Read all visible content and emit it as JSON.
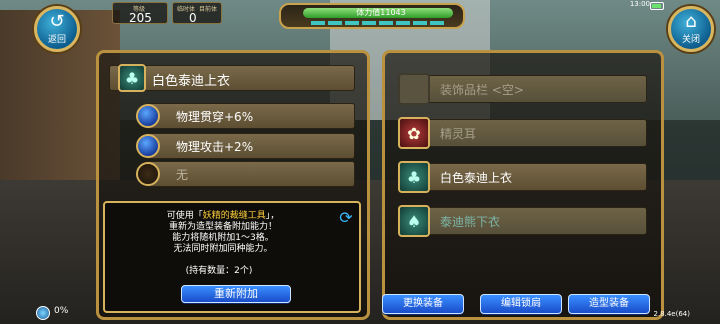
{
  "top": {
    "back_label": "返回",
    "close_label": "关闭",
    "level_label": "等级",
    "level_value": "205",
    "temp_label": "临时体",
    "second_label": "目前体",
    "second_value": "0",
    "stamina_text": "体力值11043",
    "system_time": "13:00"
  },
  "left_panel": {
    "item_name": "白色泰迪上衣",
    "attributes": [
      {
        "label": "物理贯穿+6%",
        "empty": false
      },
      {
        "label": "物理攻击+2%",
        "empty": false
      },
      {
        "label": "无",
        "empty": true
      }
    ],
    "desc_prefix": "可使用「",
    "desc_tool": "妖精的裁缝工具",
    "desc_suffix": "」，",
    "desc_line2": "重新为造型装备附加能力！",
    "desc_line3": "能力将随机附加1～3格。",
    "desc_line4": "无法同时附加同种能力。",
    "desc_count": "(持有数量：2个)",
    "reattach_button": "重新附加"
  },
  "right_panel": {
    "slots": [
      {
        "label": "装饰品栏 <空>",
        "icon": "empty-slot"
      },
      {
        "label": "精灵耳",
        "icon": "red-ribbon-icon"
      },
      {
        "label": "白色泰迪上衣",
        "icon": "teddy-top-icon"
      },
      {
        "label": "泰迪熊下衣",
        "icon": "teddy-bottom-icon"
      }
    ]
  },
  "bottom": {
    "change_equipment": "更换装备",
    "edit_lock": "编辑锁扃",
    "costume_equipment": "造型装备",
    "percent": "0%",
    "version": "2.8.4e(64)"
  }
}
